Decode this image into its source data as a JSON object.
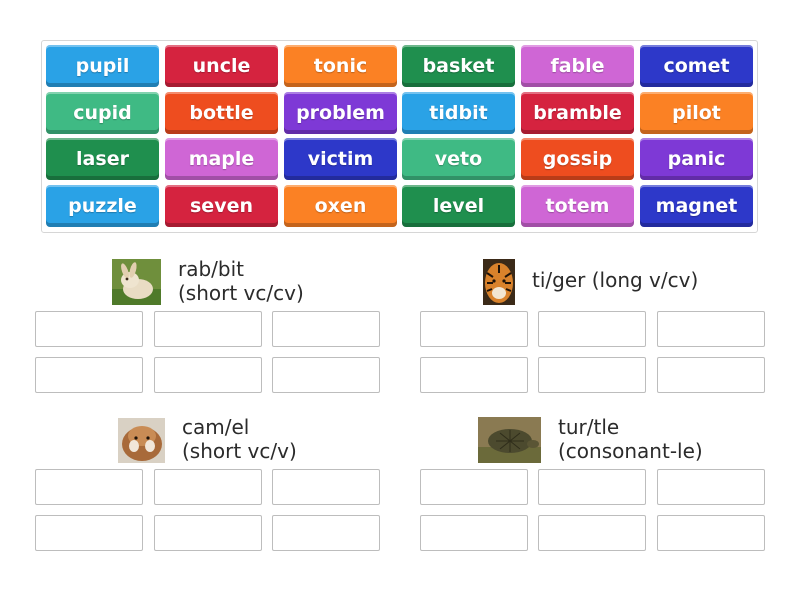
{
  "tiles": [
    {
      "label": "pupil",
      "color": "#2aa2e6"
    },
    {
      "label": "uncle",
      "color": "#d5233f"
    },
    {
      "label": "tonic",
      "color": "#fb8124"
    },
    {
      "label": "basket",
      "color": "#1f8f4e"
    },
    {
      "label": "fable",
      "color": "#cf66d5"
    },
    {
      "label": "comet",
      "color": "#2d38c9"
    },
    {
      "label": "cupid",
      "color": "#3fba84"
    },
    {
      "label": "bottle",
      "color": "#ee4d1f"
    },
    {
      "label": "problem",
      "color": "#7e39d6"
    },
    {
      "label": "tidbit",
      "color": "#2aa2e6"
    },
    {
      "label": "bramble",
      "color": "#d5233f"
    },
    {
      "label": "pilot",
      "color": "#fb8124"
    },
    {
      "label": "laser",
      "color": "#1f8f4e"
    },
    {
      "label": "maple",
      "color": "#cf66d5"
    },
    {
      "label": "victim",
      "color": "#2d38c9"
    },
    {
      "label": "veto",
      "color": "#3fba84"
    },
    {
      "label": "gossip",
      "color": "#ee4d1f"
    },
    {
      "label": "panic",
      "color": "#7e39d6"
    },
    {
      "label": "puzzle",
      "color": "#2aa2e6"
    },
    {
      "label": "seven",
      "color": "#d5233f"
    },
    {
      "label": "oxen",
      "color": "#fb8124"
    },
    {
      "label": "level",
      "color": "#1f8f4e"
    },
    {
      "label": "totem",
      "color": "#cf66d5"
    },
    {
      "label": "magnet",
      "color": "#2d38c9"
    }
  ],
  "groups": [
    {
      "label_line1": "rab/bit",
      "label_line2": "(short vc/cv)",
      "icon": "rabbit-image",
      "slots": 6
    },
    {
      "label_line1": "ti/ger (long v/cv)",
      "label_line2": "",
      "icon": "tiger-image",
      "slots": 6
    },
    {
      "label_line1": "cam/el",
      "label_line2": "(short vc/v)",
      "icon": "camel-image",
      "slots": 6
    },
    {
      "label_line1": "tur/tle",
      "label_line2": "(consonant-le)",
      "icon": "turtle-image",
      "slots": 6
    }
  ]
}
